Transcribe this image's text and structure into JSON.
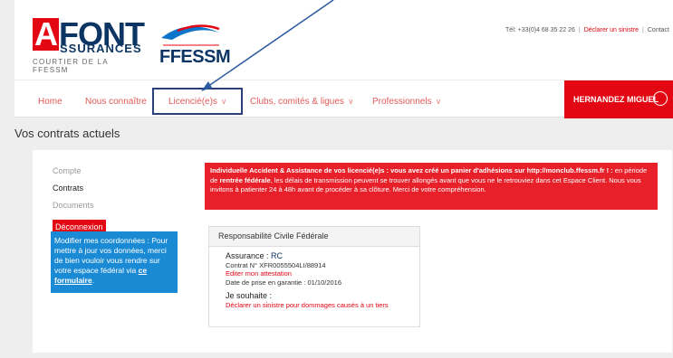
{
  "header": {
    "logo_brand": "LAFONT",
    "logo_sub": "SSURANCES",
    "logo_tagline": "COURTIER DE LA FFESSM",
    "partner_logo": "FFESSM",
    "phone": "Tél: +33(0)4 68 35 22 26",
    "declare_link": "Déclarer un sinistre",
    "contact_link": "Contact"
  },
  "nav": {
    "items": [
      {
        "label": "Home"
      },
      {
        "label": "Nous connaître"
      },
      {
        "label": "Licencié(e)s"
      },
      {
        "label": "Clubs, comités & ligues"
      },
      {
        "label": "Professionnels"
      }
    ],
    "user_name": "HERNANDEZ MIGUEL"
  },
  "page": {
    "title": "Vos contrats actuels"
  },
  "sidebar": {
    "items": [
      {
        "label": "Compte"
      },
      {
        "label": "Contrats"
      },
      {
        "label": "Documents"
      }
    ],
    "logout": "Déconnexion",
    "info_text": "Modifier mes coordonnées : Pour mettre à jour vos données, merci de bien vouloir vous rendre sur votre espace fédéral via",
    "info_link": "ce formulaire",
    "info_end": "."
  },
  "alert": {
    "bold_part": "Individuelle Accident & Assistance de vos licencié(e)s : vous avez créé un panier d'adhésions sur http://monclub.ffessm.fr ! :",
    "text_1": "en période de",
    "bold_2": "rentrée fédérale",
    "text_2": ", les délais de transmission peuvent se trouver allongés avant que vous ne le retrouviez dans cet Espace Client. Nous vous invitons à patienter 24 à 48h avant de procéder à sa clôture. Merci de votre compréhension."
  },
  "card": {
    "title": "Responsabilité Civile Fédérale",
    "assurance_label": "Assurance :",
    "assurance_value": "RC",
    "contract": "Contrat N° XFR0055504LI/88914",
    "edit_link": "Editer mon attestation",
    "date": "Date de prise en garantie : 01/10/2016",
    "wish_label": "Je souhaite :",
    "claim_link": "Déclarer un sinistre pour dommages causés à un tiers"
  }
}
